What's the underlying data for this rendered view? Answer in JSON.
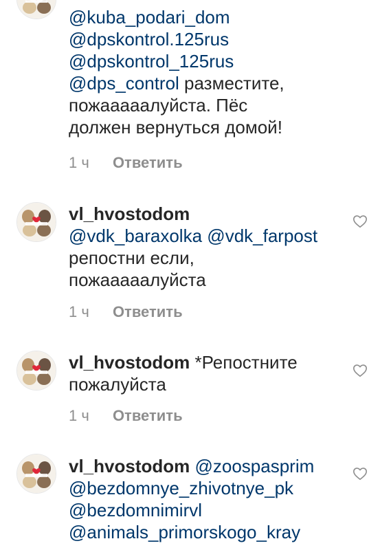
{
  "comments": [
    {
      "lines": [
        {
          "parts": [
            {
              "type": "mention",
              "text": "@kuba_podari_dom"
            }
          ]
        },
        {
          "parts": [
            {
              "type": "mention",
              "text": "@dpskontrol.125rus"
            }
          ]
        },
        {
          "parts": [
            {
              "type": "mention",
              "text": "@dpskontrol_125rus"
            }
          ]
        },
        {
          "parts": [
            {
              "type": "mention",
              "text": "@dps_control"
            },
            {
              "type": "text",
              "text": " разместите,"
            }
          ]
        },
        {
          "parts": [
            {
              "type": "text",
              "text": "пожааааалуйста. Пёс"
            }
          ]
        },
        {
          "parts": [
            {
              "type": "text",
              "text": "должен вернуться домой!"
            }
          ]
        }
      ],
      "time": "1 ч",
      "reply_label": "Ответить"
    },
    {
      "lines": [
        {
          "parts": [
            {
              "type": "username",
              "text": "vl_hvostodom"
            }
          ]
        },
        {
          "parts": [
            {
              "type": "mention",
              "text": "@vdk_baraxolka"
            },
            {
              "type": "text",
              "text": " "
            },
            {
              "type": "mention",
              "text": "@vdk_farpost"
            }
          ]
        },
        {
          "parts": [
            {
              "type": "text",
              "text": "репостни если,"
            }
          ]
        },
        {
          "parts": [
            {
              "type": "text",
              "text": "пожааааалуйста"
            }
          ]
        }
      ],
      "time": "1 ч",
      "reply_label": "Ответить"
    },
    {
      "lines": [
        {
          "parts": [
            {
              "type": "username",
              "text": "vl_hvostodom"
            },
            {
              "type": "text",
              "text": " *Репостните"
            }
          ]
        },
        {
          "parts": [
            {
              "type": "text",
              "text": "пожалуйста"
            }
          ]
        }
      ],
      "time": "1 ч",
      "reply_label": "Ответить"
    },
    {
      "lines": [
        {
          "parts": [
            {
              "type": "username",
              "text": "vl_hvostodom"
            },
            {
              "type": "text",
              "text": " "
            },
            {
              "type": "mention",
              "text": "@zoospasprim"
            }
          ]
        },
        {
          "parts": [
            {
              "type": "mention",
              "text": "@bezdomnye_zhivotnye_pk"
            }
          ]
        },
        {
          "parts": [
            {
              "type": "mention",
              "text": "@bezdomnimirvl"
            }
          ]
        },
        {
          "parts": [
            {
              "type": "mention",
              "text": "@animals_primorskogo_kray"
            }
          ]
        }
      ],
      "time": "",
      "reply_label": ""
    }
  ],
  "icons": {
    "like": "heart-outline-icon",
    "avatar": "vl-hvostodom-avatar"
  },
  "colors": {
    "text": "#262626",
    "mention": "#00376b",
    "meta": "#8e8e8e",
    "background": "#ffffff"
  }
}
